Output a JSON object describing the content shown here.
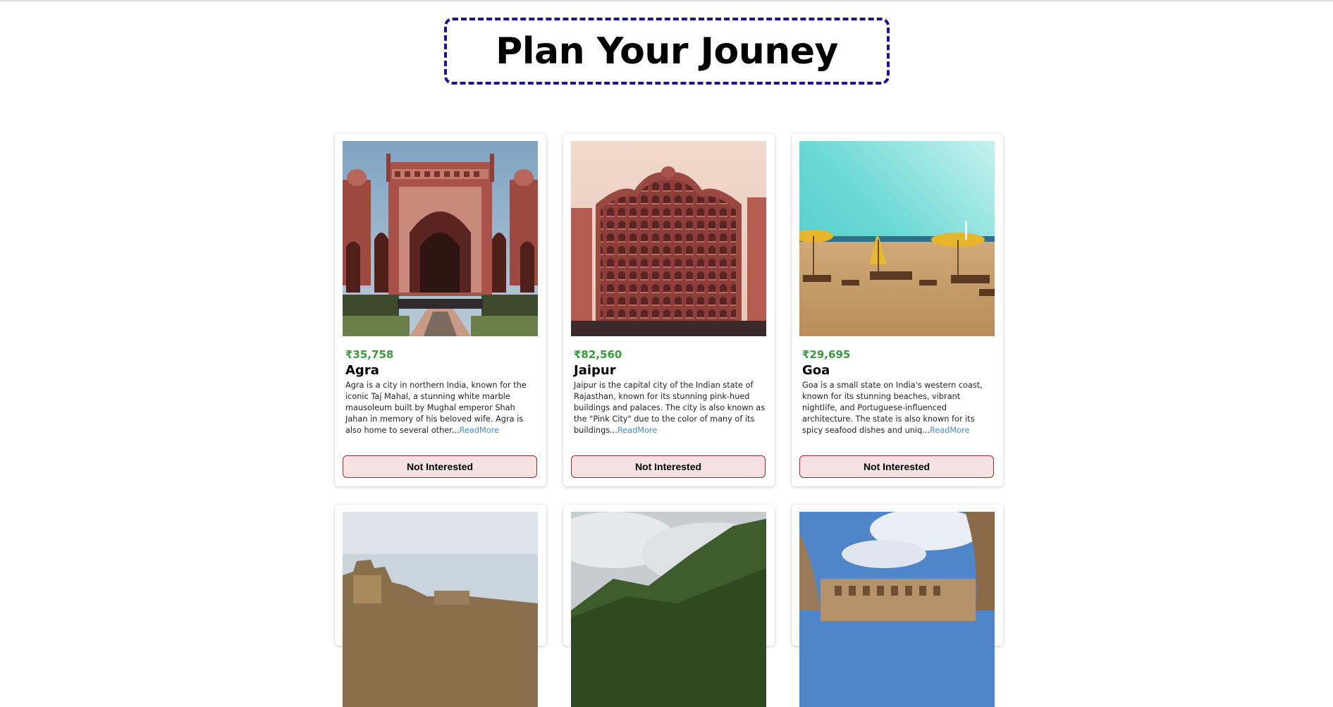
{
  "page": {
    "title": "Plan Your Jouney"
  },
  "cards": [
    {
      "price": "₹35,758",
      "name": "Agra",
      "description": "Agra is a city in northern India, known for the iconic Taj Mahal, a stunning white marble mausoleum built by Mughal emperor Shah Jahan in memory of his beloved wife. Agra is also home to several other...",
      "read_more": "ReadMore",
      "button": "Not Interested",
      "image": "agra-gateway-photo"
    },
    {
      "price": "₹82,560",
      "name": "Jaipur",
      "description": "Jaipur is the capital city of the Indian state of Rajasthan, known for its stunning pink-hued buildings and palaces. The city is also known as the \"Pink City\" due to the color of many of its buildings...",
      "read_more": "ReadMore",
      "button": "Not Interested",
      "image": "hawa-mahal-photo"
    },
    {
      "price": "₹29,695",
      "name": "Goa",
      "description": "Goa is a small state on India's western coast, known for its stunning beaches, vibrant nightlife, and Portuguese-influenced architecture. The state is also known for its spicy seafood dishes and uniq...",
      "read_more": "ReadMore",
      "button": "Not Interested",
      "image": "goa-beach-photo"
    },
    {
      "image": "varanasi-ghats-photo"
    },
    {
      "image": "misty-hills-photo"
    },
    {
      "image": "fort-courtyard-photo"
    }
  ],
  "colors": {
    "title_border": "#1b1296",
    "price": "#3b9a3b",
    "read_more": "#4a90d9",
    "button_bg": "#f5e1e1",
    "button_border": "#a32b2b"
  }
}
